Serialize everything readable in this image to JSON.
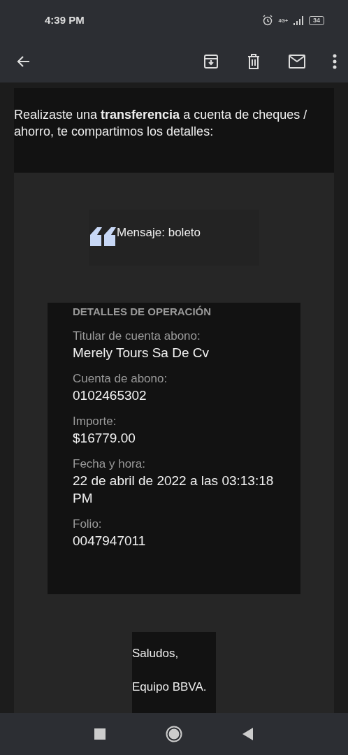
{
  "status_bar": {
    "time": "4:39 PM",
    "network": "4G+",
    "battery": "34"
  },
  "email": {
    "intro": "Realizaste una **transferencia** a cuenta de cheques / ahorro, te compartimos los detalles:",
    "quote": "Mensaje: boleto",
    "details_title": "DETALLES DE OPERACIÓN",
    "fields": [
      {
        "label": "Titular de cuenta abono:",
        "value": "Merely Tours Sa De Cv"
      },
      {
        "label": "Cuenta de abono:",
        "value": "0102465302"
      },
      {
        "label": "Importe:",
        "value": "$16779.00"
      },
      {
        "label": "Fecha y hora:",
        "value": "22 de abril de 2022 a las 03:13:18 PM"
      },
      {
        "label": "Folio:",
        "value": "0047947011"
      }
    ],
    "signature": [
      "Saludos,",
      "Equipo BBVA."
    ]
  }
}
